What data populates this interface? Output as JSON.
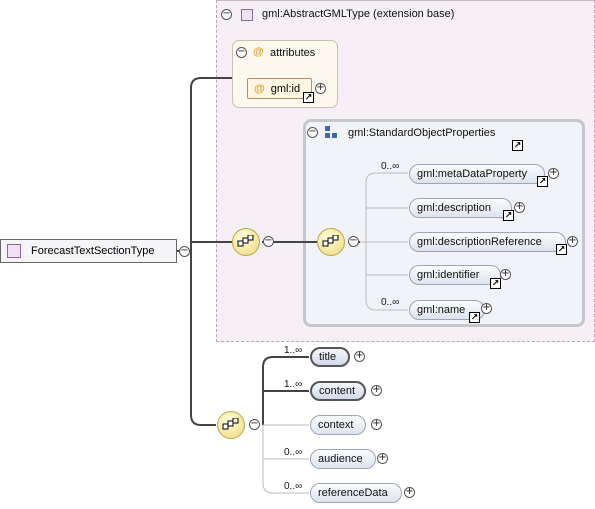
{
  "root": {
    "label": "ForecastTextSectionType"
  },
  "base_type": {
    "label": "gml:AbstractGMLType (extension base)"
  },
  "attributes_group": {
    "label": "attributes",
    "items": [
      {
        "label": "gml:id"
      }
    ]
  },
  "standard_props": {
    "label": "gml:StandardObjectProperties",
    "elements": [
      {
        "label": "gml:metaDataProperty",
        "occurrence": "0..∞"
      },
      {
        "label": "gml:description",
        "occurrence": ""
      },
      {
        "label": "gml:descriptionReference",
        "occurrence": ""
      },
      {
        "label": "gml:identifier",
        "occurrence": ""
      },
      {
        "label": "gml:name",
        "occurrence": "0..∞"
      }
    ]
  },
  "sequence_elements": [
    {
      "label": "title",
      "occurrence": "1..∞"
    },
    {
      "label": "content",
      "occurrence": "1..∞"
    },
    {
      "label": "context",
      "occurrence": ""
    },
    {
      "label": "audience",
      "occurrence": "0..∞"
    },
    {
      "label": "referenceData",
      "occurrence": "0..∞"
    }
  ],
  "symbols": {
    "collapse": "−",
    "expand": "+",
    "link": "↗",
    "attr": "@"
  },
  "colors": {
    "panel": "#f6f0f6",
    "attr_panel": "#fdf8ee",
    "compositor": "#f4e7a0",
    "element": "#dde3ee"
  }
}
